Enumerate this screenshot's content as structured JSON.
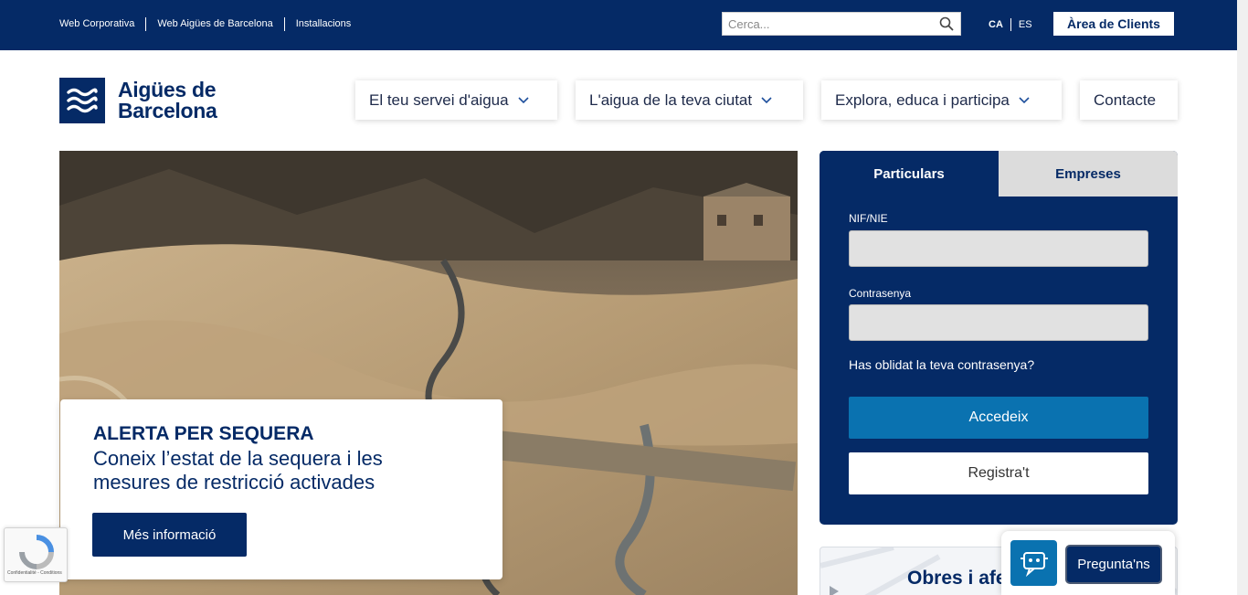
{
  "topbar": {
    "links": [
      "Web Corporativa",
      "Web Aigües de Barcelona",
      "Installacions"
    ],
    "search_placeholder": "Cerca...",
    "lang_active": "CA",
    "lang_other": "ES",
    "client_area": "Àrea de Clients"
  },
  "logo": {
    "line1": "Aigües de",
    "line2": "Barcelona"
  },
  "nav": {
    "item1": "El teu servei d'aigua",
    "item2": "L'aigua de la teva ciutat",
    "item3": "Explora, educa i participa",
    "item4": "Contacte"
  },
  "hero": {
    "alert_title": "ALERTA PER SEQUERA",
    "alert_line1": "Coneix l’estat de la sequera i les",
    "alert_line2": "mesures de restricció activades",
    "alert_button": "Més informació"
  },
  "login": {
    "tab_particulars": "Particulars",
    "tab_empreses": "Empreses",
    "nif_label": "NIF/NIE",
    "password_label": "Contrasenya",
    "forgot": "Has oblidat la teva contrasenya?",
    "access_button": "Accedeix",
    "register_button": "Registra't"
  },
  "obres": {
    "title": "Obres i afe"
  },
  "chat": {
    "button": "Pregunta'ns"
  },
  "recaptcha": {
    "text": "Confidentialité - Conditions"
  },
  "colors": {
    "brand_navy": "#052a66",
    "accent_blue": "#0a72b0"
  }
}
